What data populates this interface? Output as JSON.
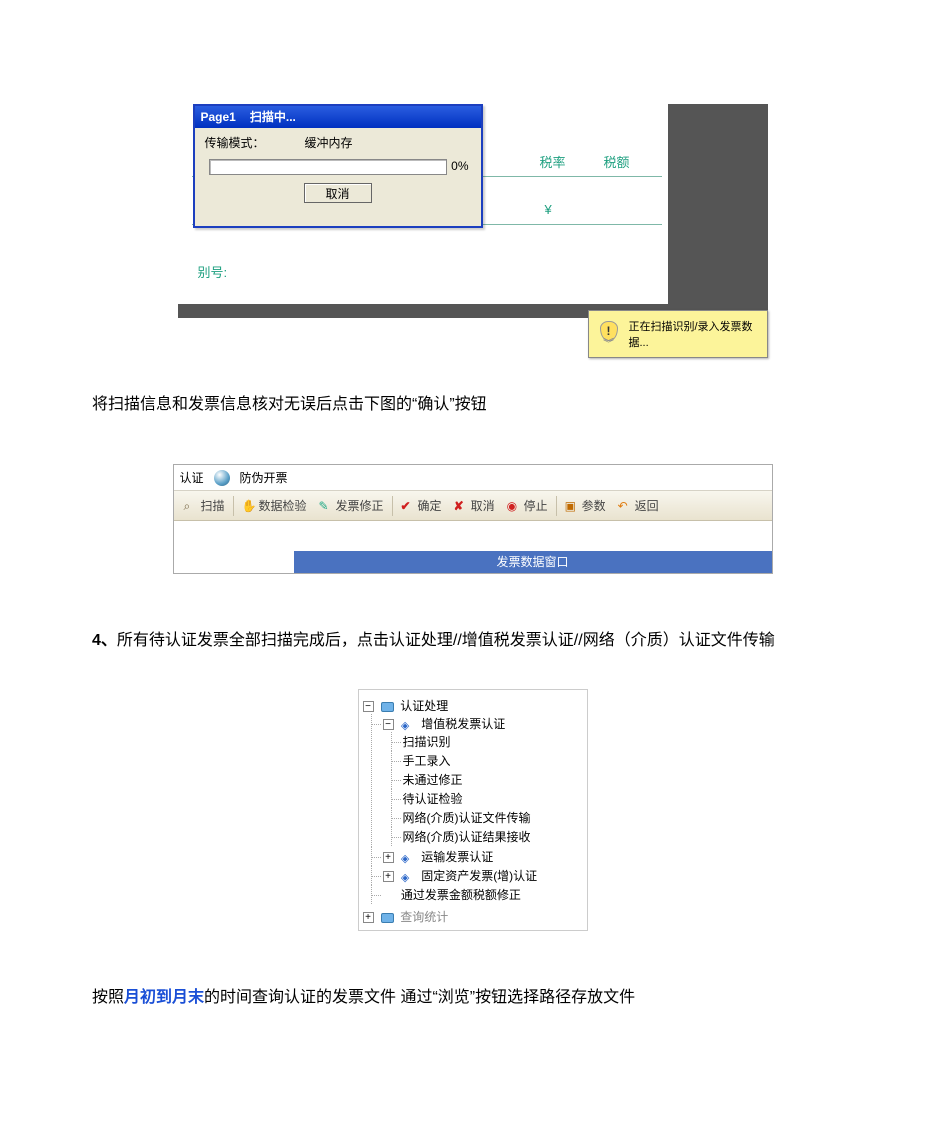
{
  "fig1": {
    "dialog": {
      "title_left": "Page1",
      "title_right": "扫描中...",
      "row_left": "传输模式：",
      "row_right": "缓冲内存",
      "progress_pct": "0%",
      "cancel_btn": "取消"
    },
    "bg_labels": {
      "tax_rate": "税率",
      "tax_amount": "税额",
      "currency": "¥",
      "id_label": "别号:"
    },
    "tooltip": {
      "shield_mark": "!",
      "text": "正在扫描识别/录入发票数据..."
    }
  },
  "para1": "将扫描信息和发票信息核对无误后点击下图的“确认”按钮",
  "fig2": {
    "menu": {
      "item1": "认证",
      "item2": "防伪开票"
    },
    "toolbar": {
      "scan": "扫描",
      "data_check": "数据检验",
      "invoice_fix": "发票修正",
      "confirm": "确定",
      "cancel": "取消",
      "stop": "停止",
      "params": "参数",
      "back": "返回"
    },
    "subtitle": "发票数据窗口"
  },
  "para2": {
    "num": "4、",
    "text_a": "所有待认证发票全部扫描完成后，点击认证处理//增值税发票认证//网络（介质）认证文件传输"
  },
  "fig3": {
    "root": "认证处理",
    "vat": "增值税发票认证",
    "vat_children": [
      "扫描识别",
      "手工录入",
      "未通过修正",
      "待认证检验",
      "网络(介质)认证文件传输",
      "网络(介质)认证结果接收"
    ],
    "transport": "运输发票认证",
    "fixed_asset": "固定资产发票(增)认证",
    "amount_fix": "通过发票金额税额修正",
    "audit": "查询统计"
  },
  "para3": {
    "pre": "按照",
    "blue": "月初到月末",
    "post": "的时间查询认证的发票文件   通过“浏览”按钮选择路径存放文件"
  }
}
